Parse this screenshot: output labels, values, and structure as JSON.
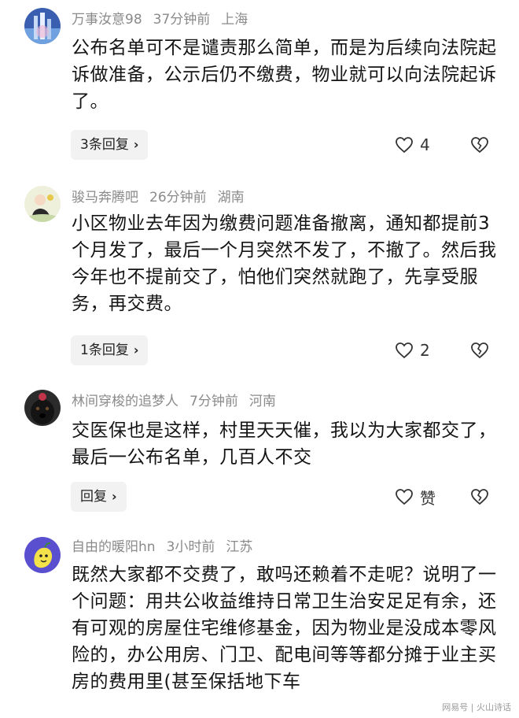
{
  "comments": [
    {
      "user": "万事汝意98",
      "time": "37分钟前",
      "location": "上海",
      "text": "公布名单可不是谴责那么简单，而是为后续向法院起诉做准备，公示后仍不缴费，物业就可以向法院起诉了。",
      "reply_label": "3条回复",
      "like_count": "4"
    },
    {
      "user": "骏马奔腾吧",
      "time": "26分钟前",
      "location": "湖南",
      "text": "小区物业去年因为缴费问题准备撤离，通知都提前3个月发了，最后一个月突然不发了，不撤了。然后我今年也不提前交了，怕他们突然就跑了，先享受服务，再交费。",
      "reply_label": "1条回复",
      "like_count": "2"
    },
    {
      "user": "林间穿梭的追梦人",
      "time": "7分钟前",
      "location": "河南",
      "text": "交医保也是这样，村里天天催，我以为大家都交了，最后一公布名单，几百人不交",
      "reply_label": "回复",
      "like_count": "赞"
    },
    {
      "user": "自由的暖阳hn",
      "time": "3小时前",
      "location": "江苏",
      "text": "既然大家都不交费了，敢吗还赖着不走呢？说明了一个问题：用共公收益维持日常卫生治安足足有余，还有可观的房屋住宅维修基金，因为物业是没成本零风险的，办公用房、门卫、配电间等等都分摊于业主买房的费用里(甚至保括地下车"
    }
  ],
  "watermark": "网易号 | 火山诗话",
  "icons": {
    "like": "heart-outline-icon",
    "dislike": "broken-heart-icon",
    "chevron": "chevron-right-icon"
  }
}
